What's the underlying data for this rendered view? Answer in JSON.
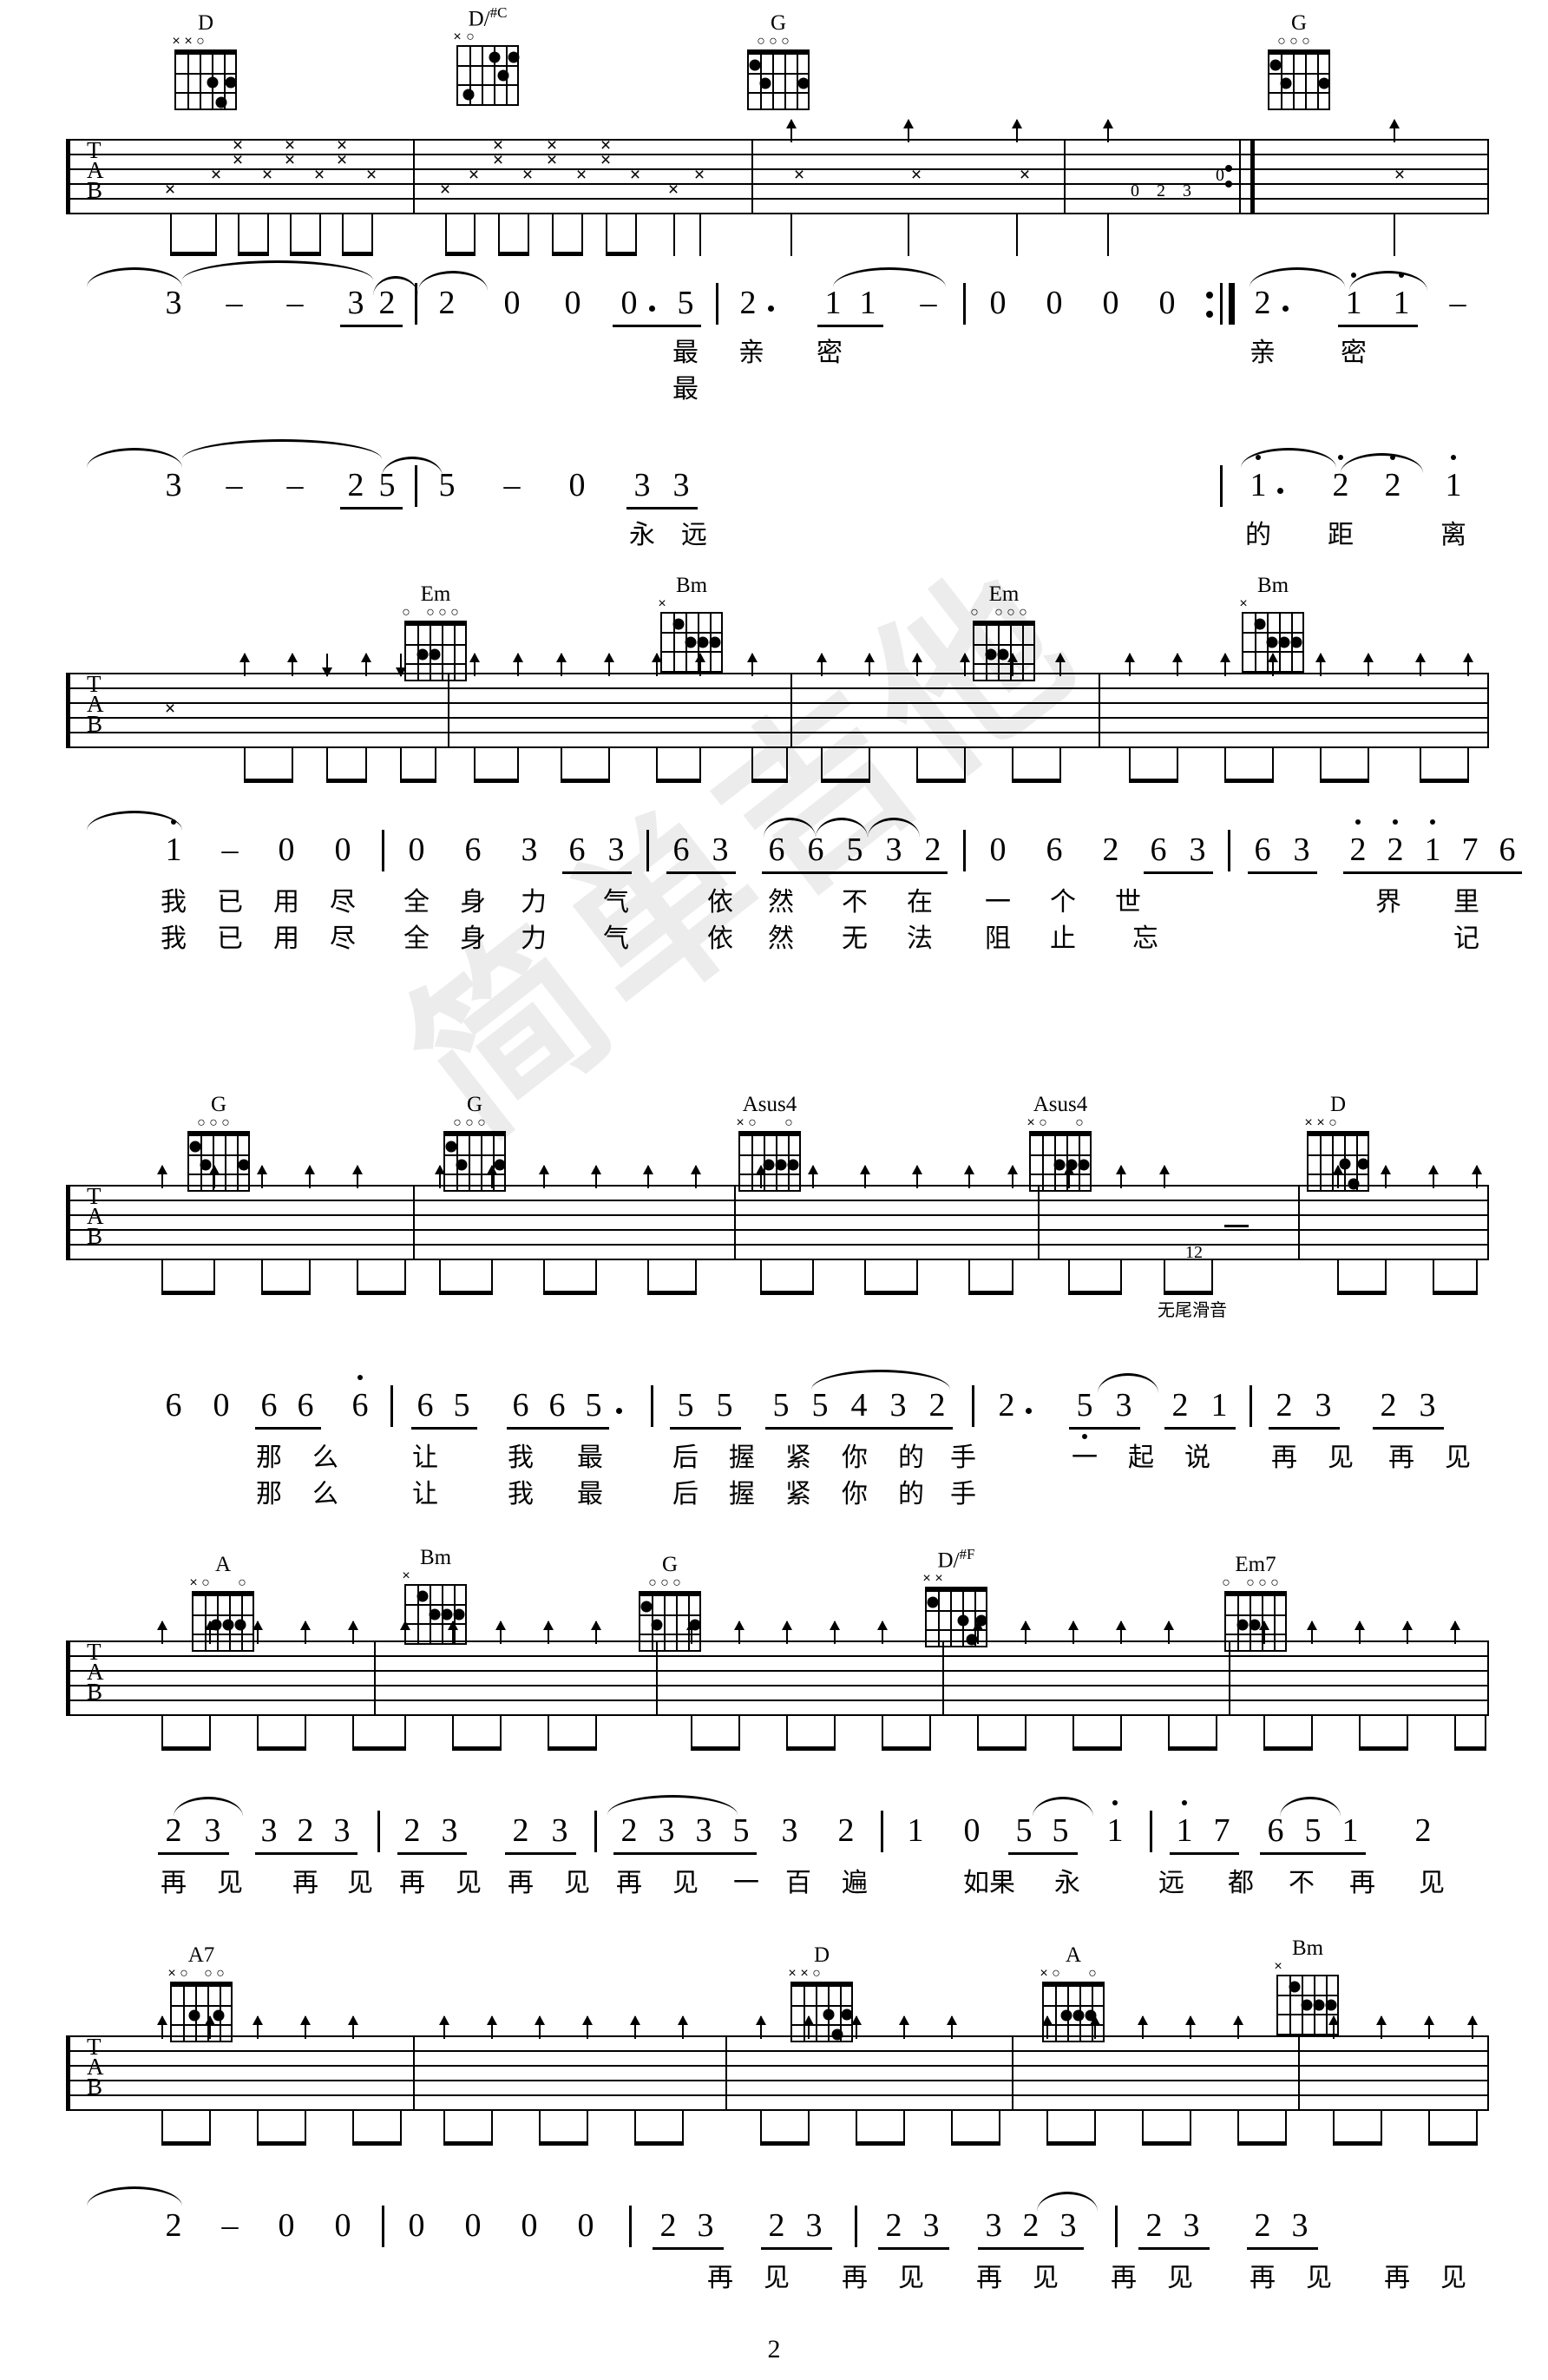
{
  "page": {
    "number": "2",
    "watermark": "简单吉他"
  },
  "systems": [
    {
      "id": "system-1",
      "chords": [
        {
          "name": "D",
          "sup": ""
        },
        {
          "name": "D/",
          "sup": "#C"
        },
        {
          "name": "G",
          "sup": ""
        },
        {
          "name": "G",
          "sup": ""
        }
      ],
      "tab_letters": "T\nA\nB",
      "fret_numbers": [
        "0",
        "2",
        "3",
        "0"
      ],
      "numeric_line": "3 - - 32 | 2 0 0 0·5 | 2· 11 - | 0 0 0 0 :|| 2· 1 1 -",
      "lyrics_row1": [
        "最",
        "亲",
        "密",
        "亲",
        "密"
      ],
      "lyrics_row2": [
        "最"
      ],
      "numeric_line2": "3 - - 25 | 5 - 0 33 | 1· 2 2 1",
      "lyrics2_row1": [
        "永",
        "远",
        "的",
        "距",
        "离"
      ]
    },
    {
      "id": "system-2",
      "chords": [
        {
          "name": "Em",
          "sup": ""
        },
        {
          "name": "Bm",
          "sup": ""
        },
        {
          "name": "Em",
          "sup": ""
        },
        {
          "name": "Bm",
          "sup": ""
        }
      ],
      "numeric_line": "1 - 0 0 | 0 6 3 63 | 63 66532 | 0 6 2 63 | 63 22176",
      "lyrics_row1": [
        "我",
        "已",
        "用",
        "尽",
        "全",
        "身",
        "力",
        "气",
        "依",
        "然",
        "不",
        "在",
        "一",
        "个",
        "世",
        "界",
        "里"
      ],
      "lyrics_row2": [
        "我",
        "已",
        "用",
        "尽",
        "全",
        "身",
        "力",
        "气",
        "依",
        "然",
        "无",
        "法",
        "阻",
        "止",
        "忘",
        "记"
      ]
    },
    {
      "id": "system-3",
      "chords": [
        {
          "name": "G",
          "sup": ""
        },
        {
          "name": "G",
          "sup": ""
        },
        {
          "name": "Asus4",
          "sup": ""
        },
        {
          "name": "Asus4",
          "sup": ""
        },
        {
          "name": "D",
          "sup": ""
        }
      ],
      "annotation": "无尾滑音",
      "fret_annotation": "12",
      "numeric_line": "6 0 66 6 | 65 665· | 55 55432 | 2· 53 21 | 23 23",
      "lyrics_row1": [
        "那",
        "么",
        "让",
        "我",
        "最",
        "后",
        "握",
        "紧",
        "你",
        "的",
        "手",
        "一",
        "起",
        "说",
        "再",
        "见",
        "再",
        "见"
      ],
      "lyrics_row2": [
        "那",
        "么",
        "让",
        "我",
        "最",
        "后",
        "握",
        "紧",
        "你",
        "的",
        "手"
      ]
    },
    {
      "id": "system-4",
      "chords": [
        {
          "name": "A",
          "sup": ""
        },
        {
          "name": "Bm",
          "sup": ""
        },
        {
          "name": "G",
          "sup": ""
        },
        {
          "name": "D/",
          "sup": "#F"
        },
        {
          "name": "Em7",
          "sup": ""
        }
      ],
      "numeric_line": "23 323 | 23 23 | 2335 3 2 | 1 0 55 1 | 17 651 2",
      "lyrics_row1": [
        "再",
        "见",
        "再",
        "见",
        "再",
        "见",
        "再",
        "见",
        "再",
        "见",
        "一",
        "百",
        "遍",
        "如果",
        "永",
        "远",
        "都",
        "不",
        "再",
        "见"
      ]
    },
    {
      "id": "system-5",
      "chords": [
        {
          "name": "A7",
          "sup": ""
        },
        {
          "name": "D",
          "sup": ""
        },
        {
          "name": "A",
          "sup": ""
        },
        {
          "name": "Bm",
          "sup": ""
        }
      ],
      "numeric_line": "2 - 0 0 | 0 0 0 0 | 23 23 | 23 323 | 23 23",
      "lyrics_row1": [
        "再",
        "见",
        "再",
        "见",
        "再",
        "见",
        "再",
        "见",
        "再",
        "见",
        "再",
        "见"
      ]
    }
  ]
}
